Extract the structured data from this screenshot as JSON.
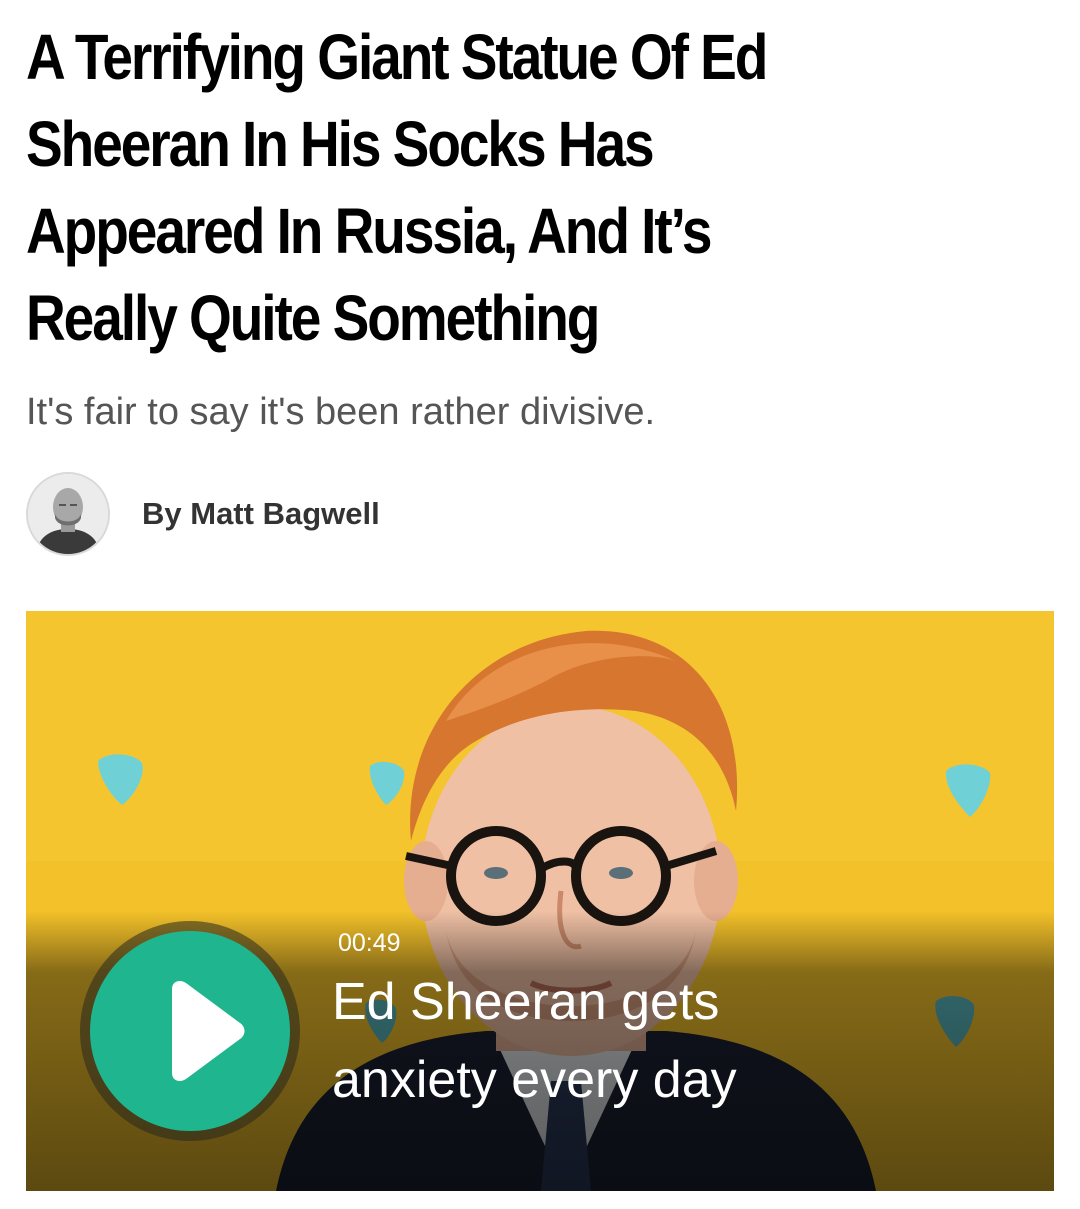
{
  "article": {
    "headline_lines": [
      "A Terrifying Giant Statue Of Ed",
      "Sheeran In His Socks Has",
      "Appeared In Russia, And It’s",
      "Really Quite Something"
    ],
    "dek": "It's fair to say it's been rather divisive.",
    "byline": "By Matt Bagwell"
  },
  "video": {
    "duration": "00:49",
    "title_lines": [
      "Ed Sheeran gets",
      "anxiety every day"
    ],
    "play_icon": "play-icon",
    "colors": {
      "play_button": "#1fb58e",
      "backdrop": "#f3c12a"
    }
  }
}
